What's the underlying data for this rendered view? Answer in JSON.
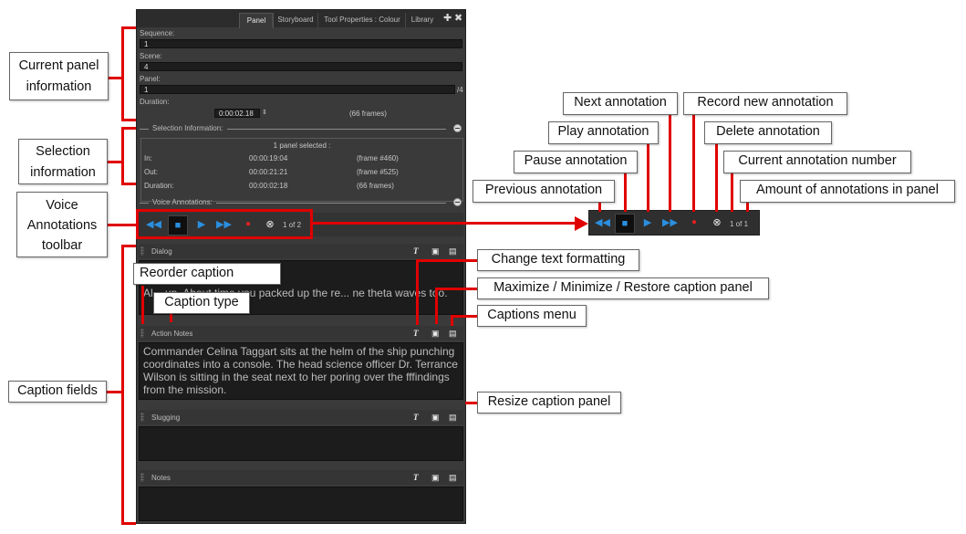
{
  "tabs": [
    "Panel",
    "Storyboard",
    "Tool Properties : Colour",
    "Library"
  ],
  "tab_icons": [
    "plus-icon",
    "close-icon"
  ],
  "panel_info": {
    "sequence_label": "Sequence:",
    "sequence_value": "1",
    "scene_label": "Scene:",
    "scene_value": "4",
    "panel_label": "Panel:",
    "panel_value": "1",
    "panel_total": "/4",
    "duration_label": "Duration:",
    "duration_value": "0:00:02.18",
    "duration_frames": "(66 frames)"
  },
  "selection": {
    "header": "Selection Information:",
    "summary": "1 panel selected :",
    "rows": [
      {
        "label": "In:",
        "time": "00:00:19:04",
        "frame": "(frame #460)"
      },
      {
        "label": "Out:",
        "time": "00:00:21:21",
        "frame": "(frame #525)"
      },
      {
        "label": "Duration:",
        "time": "00:00:02:18",
        "frame": "(66 frames)"
      }
    ]
  },
  "voice": {
    "header": "Voice Annotations:",
    "counter": "1 of 2",
    "zoom_counter": "1 of 1",
    "icons": [
      "previous-icon",
      "stop-icon",
      "play-icon",
      "next-icon",
      "record-icon",
      "delete-icon"
    ]
  },
  "captions": [
    {
      "title": "Dialog",
      "text": "Al... up. About time you packed up the re... ne theta waves too."
    },
    {
      "title": "Action Notes",
      "text": "Commander Celina Taggart sits at the helm of the ship punching coordinates into a console. The head science officer Dr. Terrance Wilson is sitting in the seat next to her poring over the fffindings from the mission."
    },
    {
      "title": "Slugging",
      "text": ""
    },
    {
      "title": "Notes",
      "text": ""
    }
  ],
  "callouts": {
    "current_panel": "Current panel information",
    "selection": "Selection information",
    "voice": "Voice Annotations toolbar",
    "caption_fields": "Caption fields",
    "reorder": "Reorder caption",
    "caption_type": "Caption type",
    "text_format": "Change text formatting",
    "maximize": "Maximize / Minimize / Restore caption panel",
    "captions_menu": "Captions menu",
    "resize": "Resize caption panel",
    "next": "Next annotation",
    "record": "Record new annotation",
    "play": "Play annotation",
    "delete": "Delete annotation",
    "pause": "Pause annotation",
    "current_number": "Current annotation number",
    "previous": "Previous annotation",
    "amount": "Amount of annotations in panel"
  },
  "colors": {
    "accent_red": "#e00000",
    "blue_icon": "#2a8fe0",
    "record_red": "#e02020"
  }
}
